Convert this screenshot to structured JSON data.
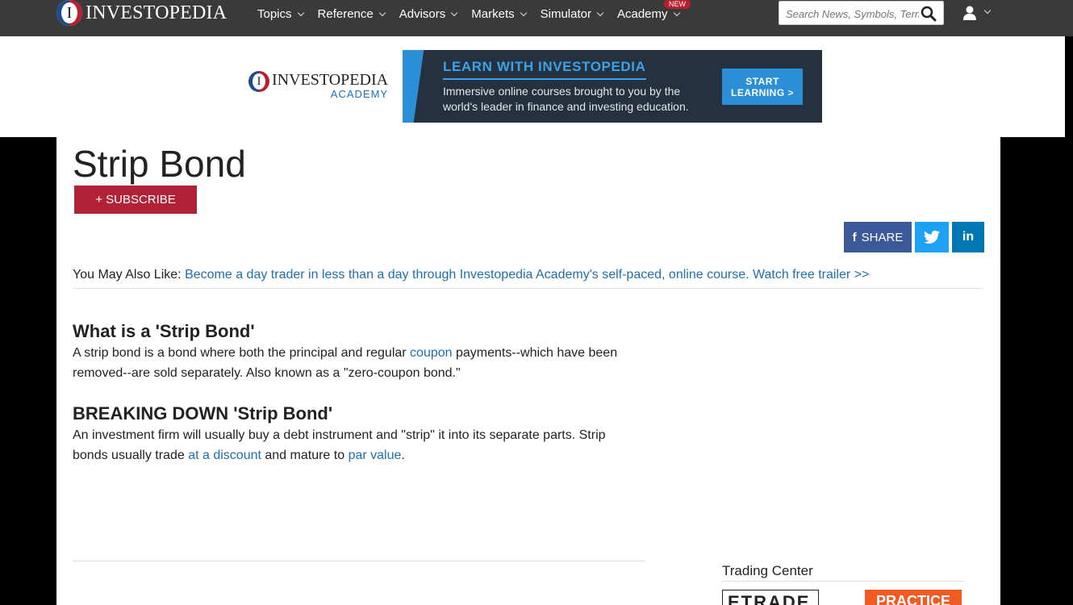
{
  "header": {
    "logo_letter": "I",
    "logo_text": "INVESTOPEDIA",
    "nav": [
      {
        "label": "Topics"
      },
      {
        "label": "Reference"
      },
      {
        "label": "Advisors"
      },
      {
        "label": "Markets"
      },
      {
        "label": "Simulator"
      },
      {
        "label": "Academy",
        "badge": "NEW"
      }
    ],
    "search": {
      "placeholder": "Search News, Symbols, Terms"
    }
  },
  "banner": {
    "academy_logo_line1": "INVESTOPEDIA",
    "academy_logo_line2": "ACADEMY",
    "ad_heading": "LEARN WITH INVESTOPEDIA",
    "ad_body": "Immersive online courses brought to you by the world's leader in finance and investing education.",
    "ad_button": "START LEARNING >"
  },
  "article": {
    "title": "Strip Bond",
    "subscribe_label": "+ SUBSCRIBE",
    "share": {
      "facebook": "SHARE",
      "linkedin": "in"
    },
    "you_may_also_like_label": "You May Also Like:",
    "you_may_also_like_link": "Become a day trader in less than a day through Investopedia Academy's self-paced, online course. Watch free trailer >>",
    "section1": {
      "heading": "What is a 'Strip Bond'",
      "text_before": "A strip bond is a bond where both the principal and regular ",
      "link": "coupon",
      "text_after": " payments--which have been removed--are sold separately. Also known as a \"zero-coupon bond.\""
    },
    "section2": {
      "heading": "BREAKING DOWN 'Strip Bond'",
      "text_before": "An investment firm will usually buy a debt instrument and \"strip\" it into its separate parts. Strip bonds usually trade ",
      "link1": "at a discount",
      "text_middle": " and mature to ",
      "link2": "par value",
      "text_end": "."
    }
  },
  "sidebar": {
    "trading_center": "Trading Center",
    "etrade_text": "ETRADE",
    "practice_text": "PRACTICE"
  },
  "colors": {
    "nav_bg": "#3a3a3a",
    "brand_red": "#b12236",
    "link_blue": "#1e6fb0",
    "facebook": "#3b5998",
    "twitter": "#1da1f2",
    "linkedin": "#0077b5"
  }
}
